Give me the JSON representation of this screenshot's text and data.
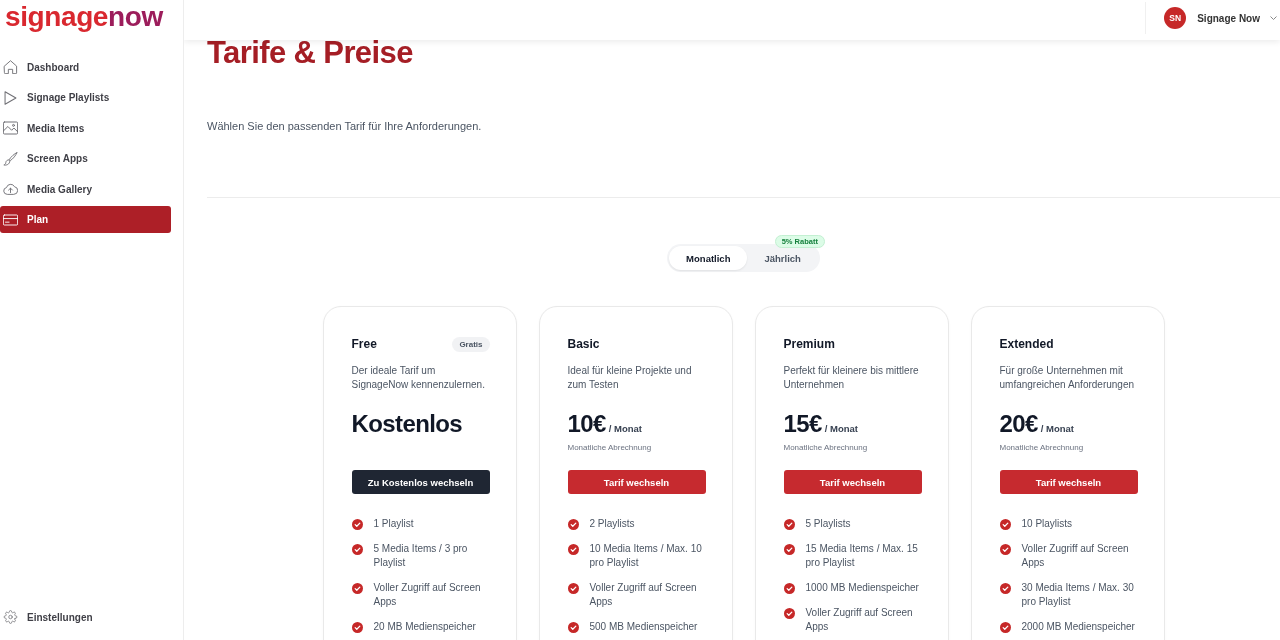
{
  "logo": {
    "text": "signage",
    "accent": "now"
  },
  "sidebar": {
    "items": [
      {
        "label": "Dashboard",
        "selected": false
      },
      {
        "label": "Signage Playlists",
        "selected": false
      },
      {
        "label": "Media Items",
        "selected": false
      },
      {
        "label": "Screen Apps",
        "selected": false
      },
      {
        "label": "Media Gallery",
        "selected": false
      },
      {
        "label": "Plan",
        "selected": true
      }
    ],
    "footer_item": {
      "label": "Einstellungen"
    }
  },
  "header": {
    "user": {
      "initials": "SN",
      "name": "Signage Now"
    }
  },
  "page": {
    "title": "Tarife & Preise",
    "subtitle": "Wählen Sie den passenden Tarif für Ihre Anforderungen."
  },
  "billing_toggle": {
    "options": [
      {
        "label": "Monatlich",
        "selected": true
      },
      {
        "label": "Jährlich",
        "selected": false
      }
    ],
    "badge": "5% Rabatt"
  },
  "plans": [
    {
      "name": "Free",
      "badge": "Gratis",
      "description": "Der ideale Tarif um SignageNow kennenzulernen.",
      "price": "Kostenlos",
      "button": {
        "label": "Zu Kostenlos wechseln",
        "kind": "dark"
      },
      "features": [
        "1 Playlist",
        "5 Media Items / 3 pro Playlist",
        "Voller Zugriff auf Screen Apps",
        "20 MB Medienspeicher"
      ]
    },
    {
      "name": "Basic",
      "description": "Ideal für kleine Projekte und zum Testen",
      "price": "10€",
      "period": "/ Monat",
      "billing_note": "Monatliche Abrechnung",
      "button": {
        "label": "Tarif wechseln",
        "kind": "primary"
      },
      "features": [
        "2 Playlists",
        "10 Media Items / Max. 10 pro Playlist",
        "Voller Zugriff auf Screen Apps",
        "500 MB Medienspeicher"
      ]
    },
    {
      "name": "Premium",
      "description": "Perfekt für kleinere bis mittlere Unternehmen",
      "price": "15€",
      "period": "/ Monat",
      "billing_note": "Monatliche Abrechnung",
      "button": {
        "label": "Tarif wechseln",
        "kind": "primary"
      },
      "features": [
        "5 Playlists",
        "15 Media Items / Max. 15 pro Playlist",
        "1000 MB Medienspeicher",
        "Voller Zugriff auf Screen Apps"
      ]
    },
    {
      "name": "Extended",
      "description": "Für große Unternehmen mit umfangreichen Anforderungen",
      "price": "20€",
      "period": "/ Monat",
      "billing_note": "Monatliche Abrechnung",
      "button": {
        "label": "Tarif wechseln",
        "kind": "primary"
      },
      "features": [
        "10 Playlists",
        "Voller Zugriff auf Screen Apps",
        "30 Media Items / Max. 30 pro Playlist",
        "2000 MB Medienspeicher"
      ]
    }
  ]
}
